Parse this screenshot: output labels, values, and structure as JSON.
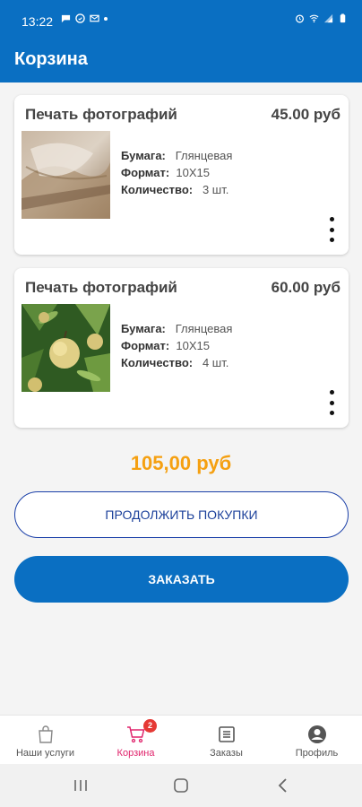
{
  "status_bar": {
    "time": "13:22"
  },
  "header": {
    "title": "Корзина"
  },
  "cart_items": [
    {
      "title": "Печать фотографий",
      "price": "45.00 руб",
      "paper_label": "Бумага:",
      "paper_value": "Глянцевая",
      "format_label": "Формат:",
      "format_value": "10X15",
      "qty_label": "Количество:",
      "qty_value": "3 шт.",
      "photo_icon": "photo-fabric-thumbnail"
    },
    {
      "title": "Печать фотографий",
      "price": "60.00 руб",
      "paper_label": "Бумага:",
      "paper_value": "Глянцевая",
      "format_label": "Формат:",
      "format_value": "10X15",
      "qty_label": "Количество:",
      "qty_value": "4 шт.",
      "photo_icon": "photo-apples-thumbnail"
    }
  ],
  "summary": {
    "total": "105,00 руб"
  },
  "actions": {
    "continue_label": "ПРОДОЛЖИТЬ ПОКУПКИ",
    "order_label": "ЗАКАЗАТЬ"
  },
  "bottom_nav": {
    "items": [
      {
        "label": "Наши услуги",
        "icon": "shopping-bag-icon"
      },
      {
        "label": "Корзина",
        "icon": "cart-icon",
        "badge": "2",
        "active": true
      },
      {
        "label": "Заказы",
        "icon": "orders-list-icon"
      },
      {
        "label": "Профиль",
        "icon": "profile-icon"
      }
    ]
  },
  "colors": {
    "primary": "#0a6fc2",
    "total": "#f5a011",
    "active_tab": "#e0246c",
    "badge": "#e53935"
  }
}
